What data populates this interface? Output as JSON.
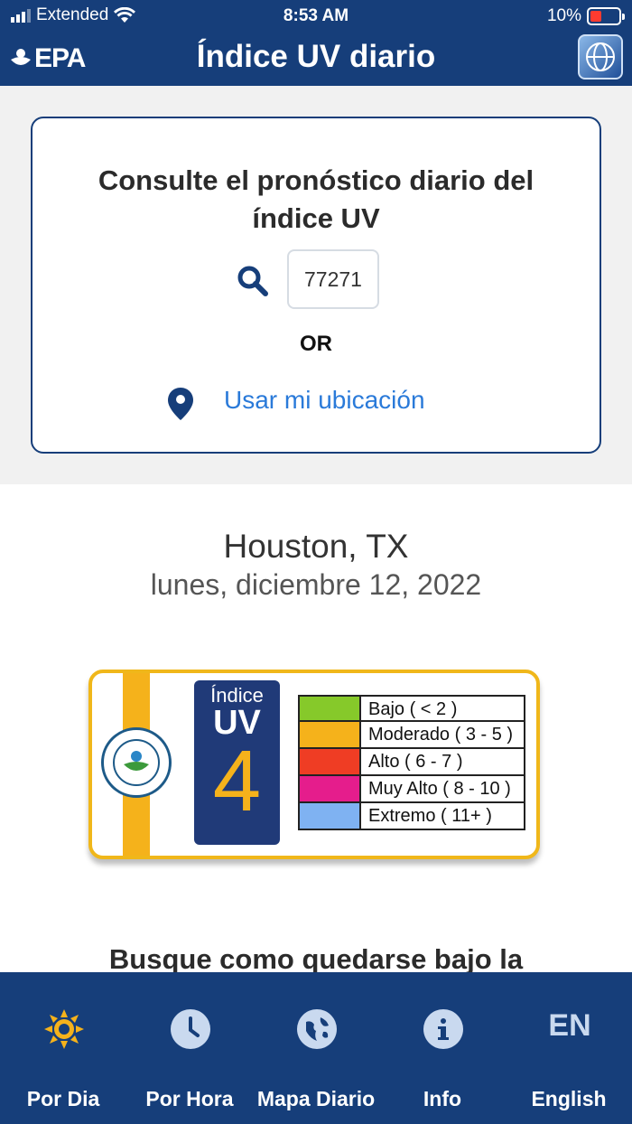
{
  "status": {
    "carrier": "Extended",
    "time": "8:53 AM",
    "battery": "10%"
  },
  "header": {
    "logo": "EPA",
    "title": "Índice UV diario",
    "menu_icon": "globe-icon"
  },
  "search": {
    "title": "Consulte el pronóstico diario del índice UV",
    "zip_value": "77271",
    "or_label": "OR",
    "location_label": "Usar mi ubicación"
  },
  "forecast": {
    "city": "Houston, TX",
    "date": "lunes, diciembre 12, 2022",
    "uv_label_top": "Índice",
    "uv_label_bottom": "UV",
    "uv_value": "4",
    "scale": [
      {
        "label": "Bajo ( < 2 )",
        "color": "#86c92a"
      },
      {
        "label": "Moderado ( 3 - 5 )",
        "color": "#f5b21b"
      },
      {
        "label": "Alto ( 6 - 7 )",
        "color": "#ef3d24"
      },
      {
        "label": "Muy Alto ( 8 - 10 )",
        "color": "#e51d8c"
      },
      {
        "label": "Extremo ( 11+ )",
        "color": "#7fb2f2"
      }
    ],
    "teaser": "Busque como quedarse bajo la"
  },
  "tabs": [
    {
      "label": "Por Dia",
      "icon": "sun-icon",
      "active": true
    },
    {
      "label": "Por Hora",
      "icon": "clock-icon",
      "active": false
    },
    {
      "label": "Mapa Diario",
      "icon": "globe-icon",
      "active": false
    },
    {
      "label": "Info",
      "icon": "info-icon",
      "active": false
    },
    {
      "label": "English",
      "icon": "EN",
      "active": false
    }
  ],
  "colors": {
    "brand": "#163e7a",
    "accent": "#f5b21b",
    "link": "#2a7ad9"
  }
}
